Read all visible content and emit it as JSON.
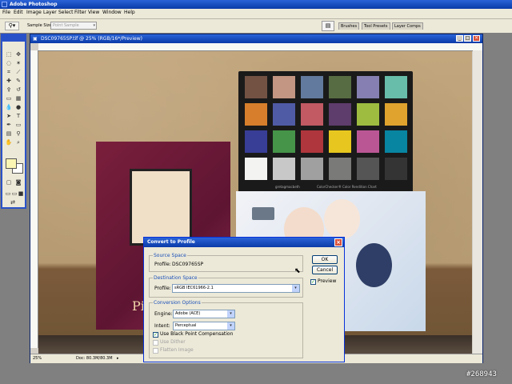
{
  "app": {
    "title": "Adobe Photoshop",
    "menu": [
      "File",
      "Edit",
      "Image",
      "Layer",
      "Select",
      "Filter",
      "View",
      "Window",
      "Help"
    ]
  },
  "options_bar": {
    "sample_size_label": "Sample Size:",
    "sample_size_value": "Point Sample",
    "palette_tabs": [
      "Brushes",
      "Tool Presets",
      "Layer Comps"
    ]
  },
  "document": {
    "title": "DSC09765SP.tif @ 25% (RGB/16*/Preview)",
    "zoom": "25%",
    "doc_size": "Doc: 80.3M/80.3M"
  },
  "dialog": {
    "title": "Convert to Profile",
    "source_space": {
      "heading": "Source Space",
      "profile_label": "Profile:",
      "profile_value": "DSC09765SP"
    },
    "destination_space": {
      "heading": "Destination Space",
      "profile_label": "Profile:",
      "profile_value": "sRGB IEC61966-2.1"
    },
    "conversion_options": {
      "heading": "Conversion Options",
      "engine_label": "Engine:",
      "engine_value": "Adobe (ACE)",
      "intent_label": "Intent:",
      "intent_value": "Perceptual",
      "black_point_label": "Use Black Point Compensation",
      "black_point_checked": true,
      "dither_label": "Use Dither",
      "dither_checked": false,
      "flatten_label": "Flatten Image",
      "flatten_checked": false
    },
    "ok_label": "OK",
    "cancel_label": "Cancel",
    "preview_label": "Preview",
    "preview_checked": true
  },
  "photo": {
    "checker_brand": "gretagmacbeth",
    "checker_caption": "ColorChecker® Color Rendition Chart",
    "poster_text": "Pier",
    "checker_colors": [
      "#735244",
      "#c29682",
      "#627a9d",
      "#576c43",
      "#8580b1",
      "#67bdaa",
      "#d67e2c",
      "#505ba6",
      "#c15a63",
      "#5e3c6c",
      "#9dbc40",
      "#e0a32e",
      "#383d96",
      "#469449",
      "#af363c",
      "#e7c71f",
      "#bb5695",
      "#0885a1",
      "#f3f3f2",
      "#c8c8c8",
      "#a0a0a0",
      "#7a7a79",
      "#555555",
      "#343434"
    ]
  },
  "watermark": "#268943"
}
